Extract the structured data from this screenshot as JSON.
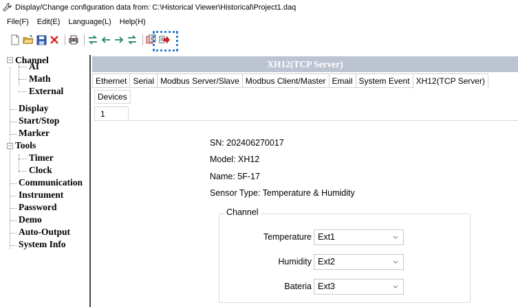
{
  "window": {
    "title": "Display/Change configuration data from: C:\\Historical Viewer\\Historical\\Project1.daq",
    "icon": "wrench-icon"
  },
  "menu": [
    {
      "label": "File(F)"
    },
    {
      "label": "Edit(E)"
    },
    {
      "label": "Language(L)"
    },
    {
      "label": "Help(H)"
    }
  ],
  "toolbar": {
    "icons": [
      "new-file-icon",
      "open-folder-icon",
      "save-icon",
      "delete-icon",
      "printer-icon",
      "transfer-icon",
      "arrow-left-icon",
      "arrow-right-icon",
      "swap-icon",
      "copy-icon",
      "export-icon"
    ],
    "highlight_color": "#2a7bd0"
  },
  "tree": {
    "items": [
      {
        "label": "Channel"
      },
      {
        "label": "AI"
      },
      {
        "label": "Math"
      },
      {
        "label": "External"
      },
      {
        "label": "Display"
      },
      {
        "label": "Start/Stop"
      },
      {
        "label": "Marker"
      },
      {
        "label": "Tools"
      },
      {
        "label": "Timer"
      },
      {
        "label": "Clock"
      },
      {
        "label": "Communication"
      },
      {
        "label": "Instrument"
      },
      {
        "label": "Password"
      },
      {
        "label": "Demo"
      },
      {
        "label": "Auto-Output"
      },
      {
        "label": "System Info"
      }
    ]
  },
  "header": {
    "title": "XH12(TCP Server)",
    "band_color": "#bcc4d2"
  },
  "tabs": [
    {
      "label": "Ethernet"
    },
    {
      "label": "Serial"
    },
    {
      "label": "Modbus Server/Slave"
    },
    {
      "label": "Modbus Client/Master"
    },
    {
      "label": "Email"
    },
    {
      "label": "System Event"
    },
    {
      "label": "XH12(TCP Server)",
      "active": true
    }
  ],
  "subtabs": [
    {
      "label": "Devices"
    }
  ],
  "pagetabs": [
    {
      "label": "1"
    }
  ],
  "device": {
    "sn": "SN: 202406270017",
    "model": "Model: XH12",
    "name": "Name: 5F-17",
    "sensor_type": "Sensor Type: Temperature & Humidity"
  },
  "channel_group": {
    "label": "Channel",
    "fields": [
      {
        "label": "Temperature",
        "value": "Ext1"
      },
      {
        "label": "Humidity",
        "value": "Ext2"
      },
      {
        "label": "Bateria",
        "value": "Ext3"
      }
    ]
  }
}
